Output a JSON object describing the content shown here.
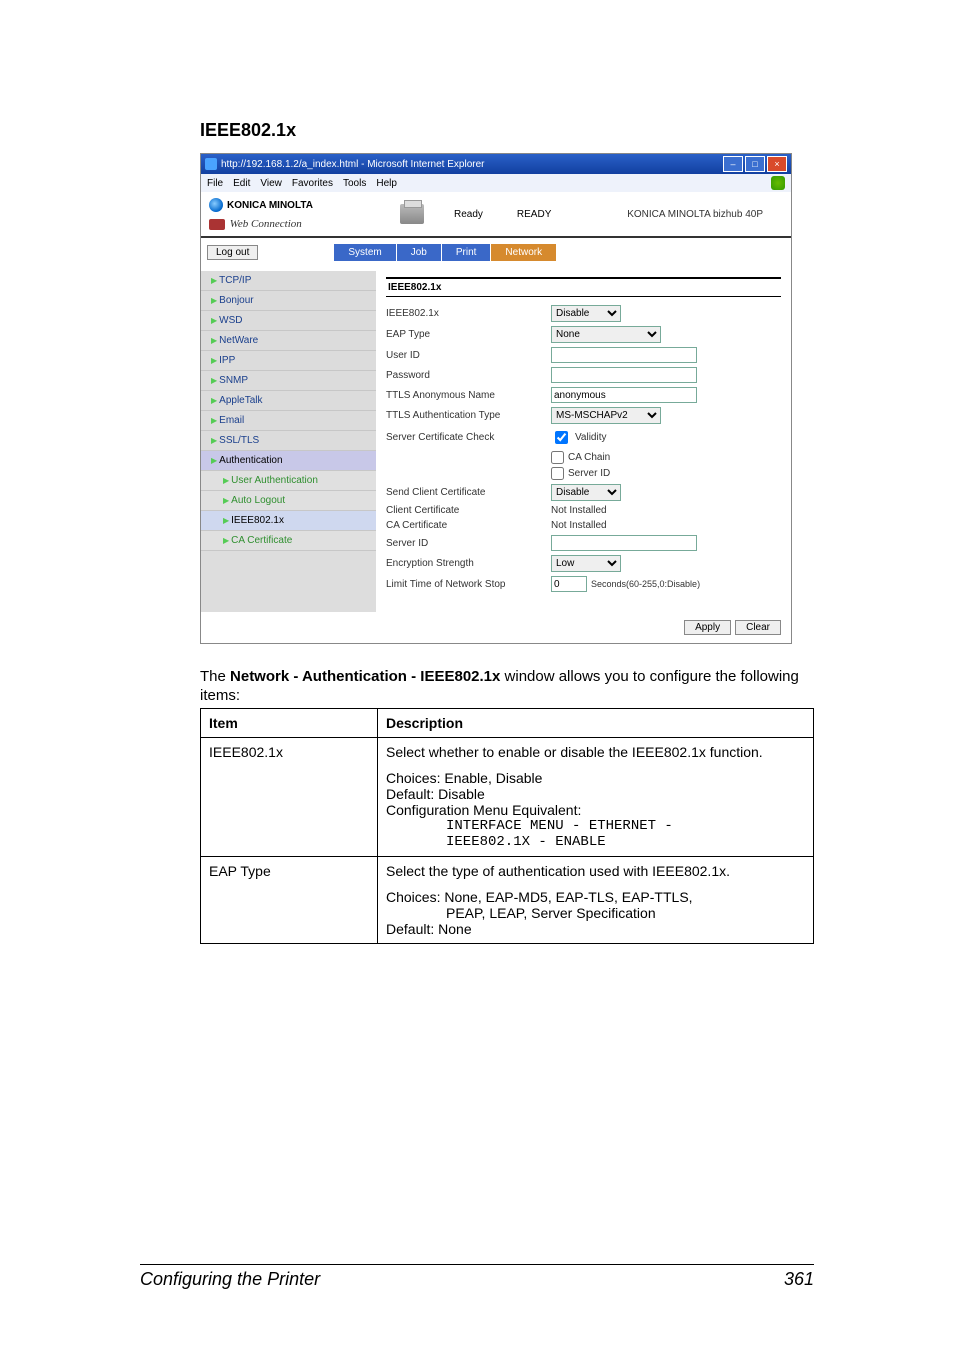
{
  "page_title": "IEEE802.1x",
  "browser": {
    "title": "http://192.168.1.2/a_index.html - Microsoft Internet Explorer",
    "menus": [
      "File",
      "Edit",
      "View",
      "Favorites",
      "Tools",
      "Help"
    ]
  },
  "header": {
    "brand": "KONICA MINOLTA",
    "product_line": "Web Connection",
    "status_label": "Ready",
    "status_banner": "READY",
    "model": "KONICA MINOLTA bizhub 40P",
    "logout": "Log out",
    "tabs": [
      "System",
      "Job",
      "Print",
      "Network"
    ]
  },
  "sidebar": {
    "items": [
      {
        "label": "TCP/IP"
      },
      {
        "label": "Bonjour"
      },
      {
        "label": "WSD"
      },
      {
        "label": "NetWare"
      },
      {
        "label": "IPP"
      },
      {
        "label": "SNMP"
      },
      {
        "label": "AppleTalk"
      },
      {
        "label": "Email"
      },
      {
        "label": "SSL/TLS"
      },
      {
        "label": "Authentication"
      },
      {
        "label": "User Authentication"
      },
      {
        "label": "Auto Logout"
      },
      {
        "label": "IEEE802.1x"
      },
      {
        "label": "CA Certificate"
      }
    ]
  },
  "panel": {
    "title": "IEEE802.1x",
    "ieee_label": "IEEE802.1x",
    "ieee_value": "Disable",
    "eap_type_label": "EAP Type",
    "eap_type_value": "None",
    "user_id_label": "User ID",
    "user_id_value": "",
    "password_label": "Password",
    "password_value": "",
    "ttls_anon_label": "TTLS Anonymous Name",
    "ttls_anon_value": "anonymous",
    "ttls_auth_label": "TTLS Authentication Type",
    "ttls_auth_value": "MS-MSCHAPv2",
    "server_cert_label": "Server Certificate Check",
    "cb_validity": "Validity",
    "cb_ca_chain": "CA Chain",
    "cb_server_id": "Server ID",
    "send_client_cert_label": "Send Client Certificate",
    "send_client_cert_value": "Disable",
    "client_cert_label": "Client Certificate",
    "client_cert_value": "Not Installed",
    "ca_cert_label": "CA Certificate",
    "ca_cert_value": "Not Installed",
    "server_id_label": "Server ID",
    "server_id_value": "",
    "enc_strength_label": "Encryption Strength",
    "enc_strength_value": "Low",
    "limit_time_label": "Limit Time of Network Stop",
    "limit_time_value": "0",
    "limit_time_hint": "Seconds(60-255,0:Disable)",
    "apply": "Apply",
    "clear": "Clear"
  },
  "intro_pre": "The ",
  "intro_bold": "Network - Authentication - IEEE802.1x",
  "intro_post": " window allows you to configure the following items:",
  "table": {
    "head_item": "Item",
    "head_desc": "Description",
    "rows": [
      {
        "item": "IEEE802.1x",
        "p1": "Select whether to enable or disable the IEEE802.1x function.",
        "p2a": "Choices: Enable, Disable",
        "p2b": "Default:  Disable",
        "p2c": "Configuration Menu Equivalent:",
        "mono1": "INTERFACE MENU - ETHERNET -",
        "mono2": "IEEE802.1X - ENABLE"
      },
      {
        "item": "EAP Type",
        "p1": "Select the type of authentication used with IEEE802.1x.",
        "p2a": "Choices: None, EAP-MD5, EAP-TLS, EAP-TTLS, ",
        "p2b": "PEAP, LEAP, Server Specification",
        "p2c": "Default:  None"
      }
    ]
  },
  "footer": {
    "left": "Configuring the Printer",
    "right": "361"
  }
}
